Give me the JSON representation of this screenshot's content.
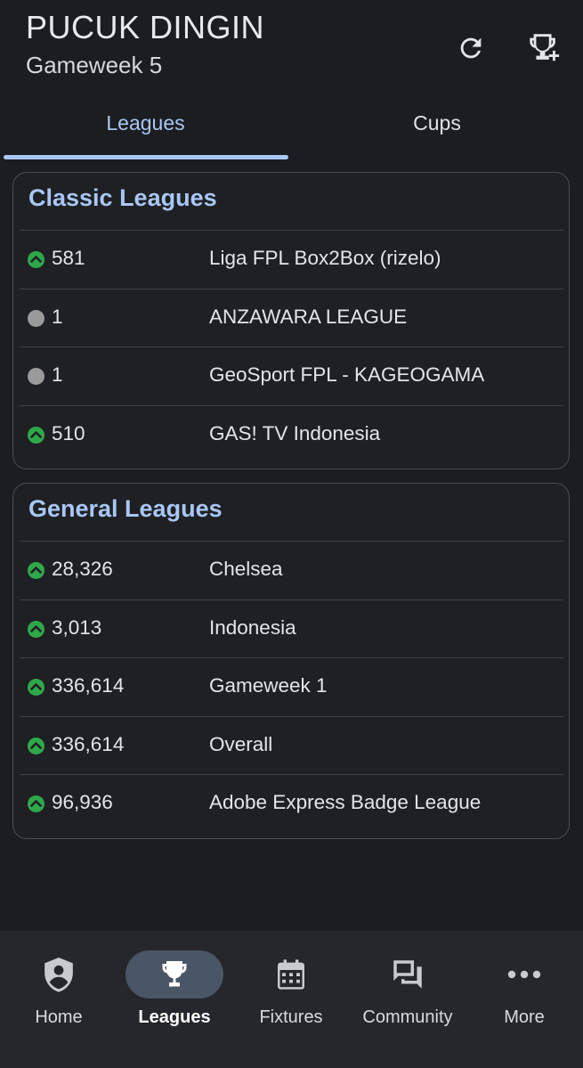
{
  "header": {
    "team_name": "PUCUK DINGIN",
    "gameweek": "Gameweek 5",
    "icons": [
      "refresh-icon",
      "trophy-add-icon"
    ]
  },
  "tabs": [
    {
      "label": "Leagues",
      "active": true
    },
    {
      "label": "Cups",
      "active": false
    }
  ],
  "classic_leagues": {
    "title": "Classic Leagues",
    "rows": [
      {
        "movement": "up",
        "rank": "581",
        "name": "Liga FPL Box2Box (rizelo)"
      },
      {
        "movement": "same",
        "rank": "1",
        "name": "ANZAWARA LEAGUE"
      },
      {
        "movement": "same",
        "rank": "1",
        "name": "GeoSport FPL - KAGEOGAMA"
      },
      {
        "movement": "up",
        "rank": "510",
        "name": "GAS! TV Indonesia"
      }
    ]
  },
  "general_leagues": {
    "title": "General Leagues",
    "rows": [
      {
        "movement": "up",
        "rank": "28,326",
        "name": "Chelsea"
      },
      {
        "movement": "up",
        "rank": "3,013",
        "name": "Indonesia"
      },
      {
        "movement": "up",
        "rank": "336,614",
        "name": "Gameweek 1"
      },
      {
        "movement": "up",
        "rank": "336,614",
        "name": "Overall"
      },
      {
        "movement": "up",
        "rank": "96,936",
        "name": "Adobe Express Badge League"
      }
    ]
  },
  "bottom_nav": [
    {
      "label": "Home",
      "icon": "shield-person-icon",
      "active": false
    },
    {
      "label": "Leagues",
      "icon": "trophy-icon",
      "active": true
    },
    {
      "label": "Fixtures",
      "icon": "calendar-icon",
      "active": false
    },
    {
      "label": "Community",
      "icon": "forum-icon",
      "active": false
    },
    {
      "label": "More",
      "icon": "more-horizontal-icon",
      "active": false
    }
  ],
  "colors": {
    "background": "#1b1d20",
    "accent": "#a9c7f3",
    "up_status": "#2fa84a",
    "same_status": "#9a9a9a",
    "nav_background": "#25272c",
    "nav_active_pill": "#4a5566"
  }
}
